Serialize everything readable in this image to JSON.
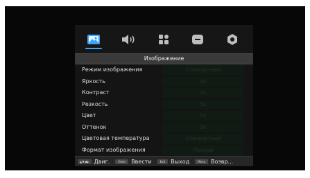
{
  "tabs": [
    {
      "icon": "picture-icon",
      "active": true
    },
    {
      "icon": "sound-icon",
      "active": false
    },
    {
      "icon": "options-grid-icon",
      "active": false
    },
    {
      "icon": "timer-icon",
      "active": false
    },
    {
      "icon": "settings-gear-icon",
      "active": false
    }
  ],
  "title": "Изображение",
  "rows": [
    {
      "label": "Режим изображения",
      "value": "Стандартный"
    },
    {
      "label": "Яркость",
      "value": "50"
    },
    {
      "label": "Контраст",
      "value": "50"
    },
    {
      "label": "Резкость",
      "value": "50"
    },
    {
      "label": "Цвет",
      "value": "50"
    },
    {
      "label": "Оттенок",
      "value": "50"
    },
    {
      "label": "Цветовая температура",
      "value": "Стандартный"
    },
    {
      "label": "Формат изображения",
      "value": "Полный"
    }
  ],
  "footer": {
    "arrows_key": "▲▼◀▶",
    "move_label": "Двиг.",
    "enter_key": "Enter",
    "enter_label": "Ввести",
    "exit_key": "Exit",
    "exit_label": "Выход",
    "menu_key": "Menu",
    "menu_label": "Возвр..."
  },
  "colors": {
    "active_tab": "#3aa3ff",
    "icon": "#bdbdbd"
  }
}
